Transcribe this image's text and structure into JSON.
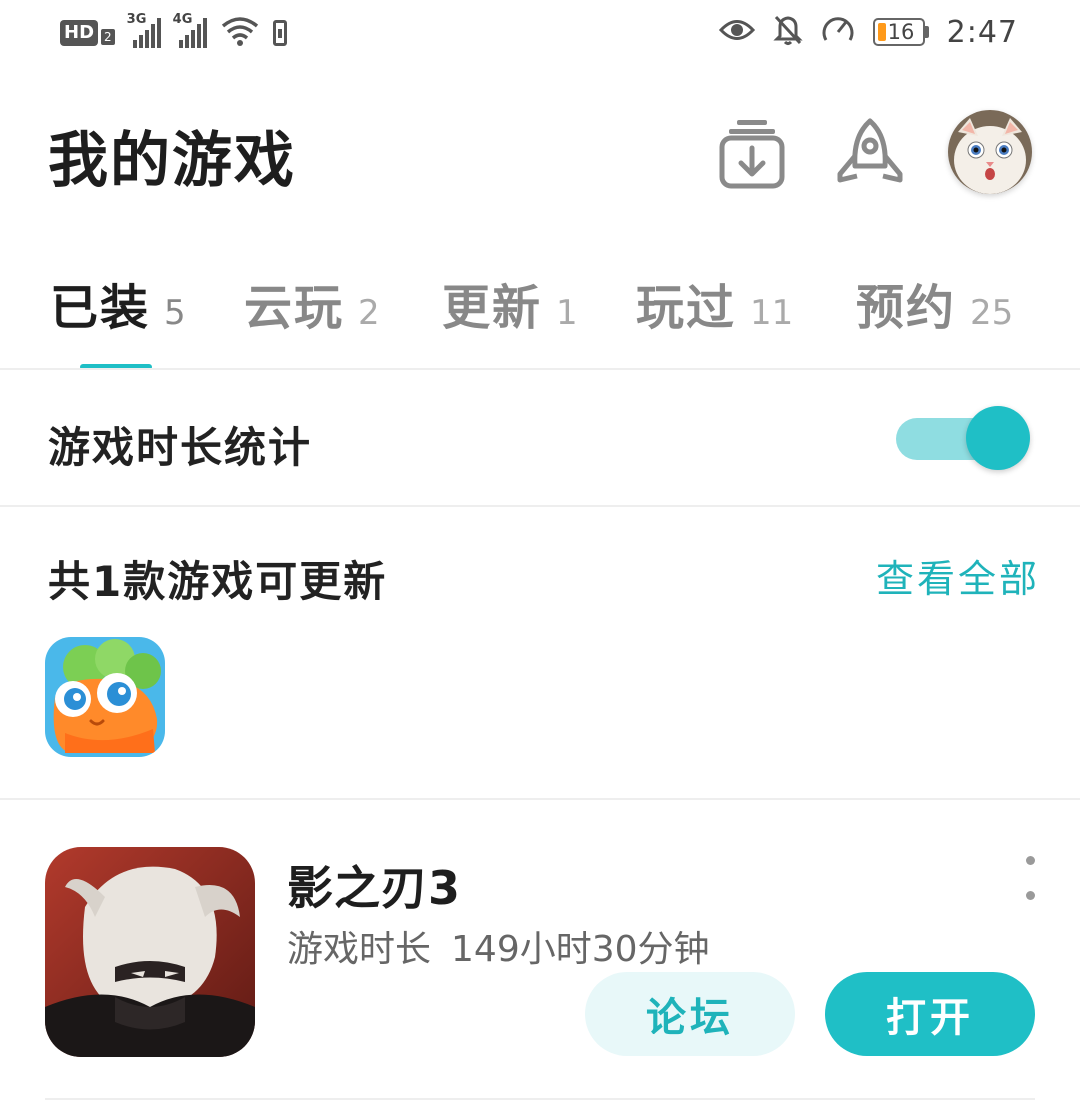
{
  "status_bar": {
    "hd_label": "HD",
    "hd_sub": "2",
    "network1": "3G",
    "network2": "4G",
    "battery_level": "16",
    "time": "2:47",
    "icons": [
      "eye-icon",
      "bell-off-icon",
      "speedometer-icon",
      "wifi-icon",
      "battery-icon"
    ]
  },
  "header": {
    "title": "我的游戏",
    "icons": [
      "download-manager-icon",
      "rocket-icon"
    ],
    "avatar": "user-avatar"
  },
  "tabs": [
    {
      "label": "已装",
      "count": "5",
      "active": true
    },
    {
      "label": "云玩",
      "count": "2",
      "active": false
    },
    {
      "label": "更新",
      "count": "1",
      "active": false
    },
    {
      "label": "玩过",
      "count": "11",
      "active": false
    },
    {
      "label": "预约",
      "count": "25",
      "active": false
    }
  ],
  "stats": {
    "label": "游戏时长统计",
    "toggle_on": true
  },
  "updates": {
    "title": "共1款游戏可更新",
    "view_all": "查看全部"
  },
  "game": {
    "name": "影之刃3",
    "playtime_label": "游戏时长",
    "playtime_value": "149小时30分钟",
    "forum_button": "论坛",
    "open_button": "打开"
  },
  "colors": {
    "accent": "#1fbfc6",
    "accent_light": "#8fdde1",
    "forum_bg": "#e8f8f9",
    "battery_low": "#ff9a1a"
  }
}
